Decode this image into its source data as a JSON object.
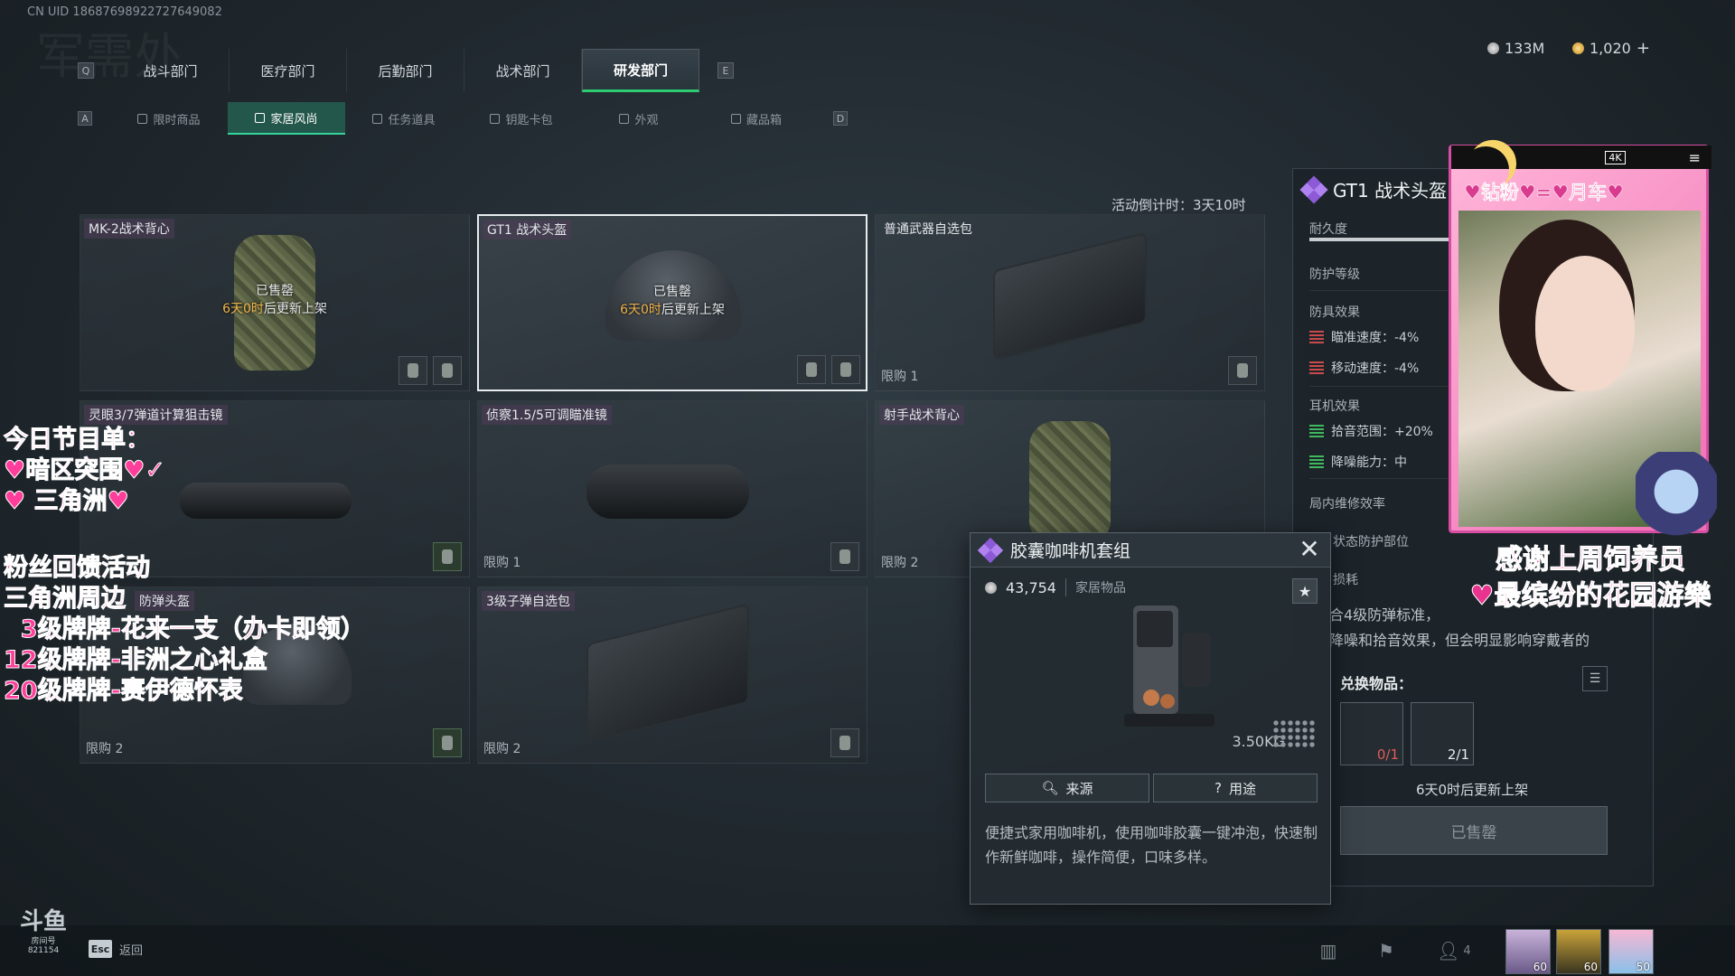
{
  "uid": "CN UID 18687698922727649082",
  "watermark": "军需处",
  "dept_tabs": {
    "left_key": "Q",
    "right_key": "E",
    "items": [
      "战斗部门",
      "医疗部门",
      "后勤部门",
      "战术部门",
      "研发部门"
    ],
    "active": "研发部门"
  },
  "currency": {
    "silver": "133M",
    "gold": "1,020",
    "add": "+"
  },
  "sub_tabs": {
    "left_key": "A",
    "right_key": "D",
    "items": [
      "限时商品",
      "家居风尚",
      "任务道具",
      "钥匙卡包",
      "外观",
      "藏品箱"
    ],
    "active": "家居风尚"
  },
  "countdown": "活动倒计时：3天10时",
  "cards": [
    {
      "name": "MK-2战术背心",
      "sold": "已售罄",
      "restock_hl": "6天0时",
      "restock_rest": "后更新上架",
      "limit": ""
    },
    {
      "name": "GT1 战术头盔",
      "sold": "已售罄",
      "restock_hl": "6天0时",
      "restock_rest": "后更新上架",
      "limit": ""
    },
    {
      "name": "普通武器自选包",
      "sold": "",
      "restock_hl": "",
      "restock_rest": "",
      "limit": "限购 1"
    },
    {
      "name": "灵眼3/7弹道计算狙击镜",
      "sold": "",
      "restock_hl": "",
      "restock_rest": "",
      "limit": ""
    },
    {
      "name": "侦察1.5/5可调瞄准镜",
      "sold": "",
      "restock_hl": "",
      "restock_rest": "",
      "limit": "限购 1"
    },
    {
      "name": "射手战术背心",
      "sold": "",
      "restock_hl": "",
      "restock_rest": "",
      "limit": "限购 2"
    },
    {
      "name": "防弹头盔",
      "sold": "",
      "restock_hl": "",
      "restock_rest": "",
      "limit": "限购 2"
    },
    {
      "name": "3级子弹自选包",
      "sold": "",
      "restock_hl": "",
      "restock_rest": "",
      "limit": "限购 2"
    }
  ],
  "detail": {
    "title": "GT1 战术头盔",
    "durability": "耐久度",
    "protection": "防护等级",
    "armor_effects": "防具效果",
    "aim_speed": "瞄准速度：-4%",
    "move_speed": "移动速度：-4%",
    "ear_effects": "耳机效果",
    "pickup_range": "拾音范围：+20%",
    "noise_reduction": "降噪能力：中",
    "repair": "局内维修效率",
    "status_parts": "状态防护部位",
    "loss": "损耗",
    "desc_1": "合4级防弹标准，",
    "desc_2": "降噪和拾音效果，但会明显影响穿戴者的",
    "exchange_title": "兑换物品：",
    "exchange_items": [
      {
        "count": "0/1"
      },
      {
        "count": "2/1"
      }
    ],
    "restock": "6天0时后更新上架",
    "sold_button": "已售罄"
  },
  "popup": {
    "title": "胶囊咖啡机套组",
    "price": "43,754",
    "category": "家居物品",
    "weight": "3.50KG",
    "source_btn": "来源",
    "use_btn": "用途",
    "description": "便捷式家用咖啡机，使用咖啡胶囊一键冲泡，快速制作新鲜咖啡，操作简便，口味多样。"
  },
  "streamer": {
    "cam_quality": "4K",
    "banner": "♥钻粉♥=♥月车♥",
    "thanks_1": "感谢上周饲养员",
    "thanks_2": "♥最缤纷的花园游樂",
    "program_lines": [
      "今日节目单：",
      "♥暗区突围♥✓",
      "♥  三角洲♥"
    ],
    "fan_lines": [
      "粉丝回馈活动",
      "三角洲周边",
      "  3级牌牌-花来一支（办卡即领）",
      "12级牌牌-非洲之心礼盒",
      "20级牌牌-赛伊德怀表"
    ]
  },
  "bottom": {
    "room_label": "房间号",
    "room_number": "821154",
    "esc_key": "Esc",
    "back_label": "返回",
    "friends_count": "4",
    "avatar_levels": [
      "60",
      "60",
      "50"
    ]
  },
  "colors": {
    "accent_green": "#2ecc71",
    "sold_orange": "#f0b44a",
    "streamer_pink": "#e8338f"
  }
}
